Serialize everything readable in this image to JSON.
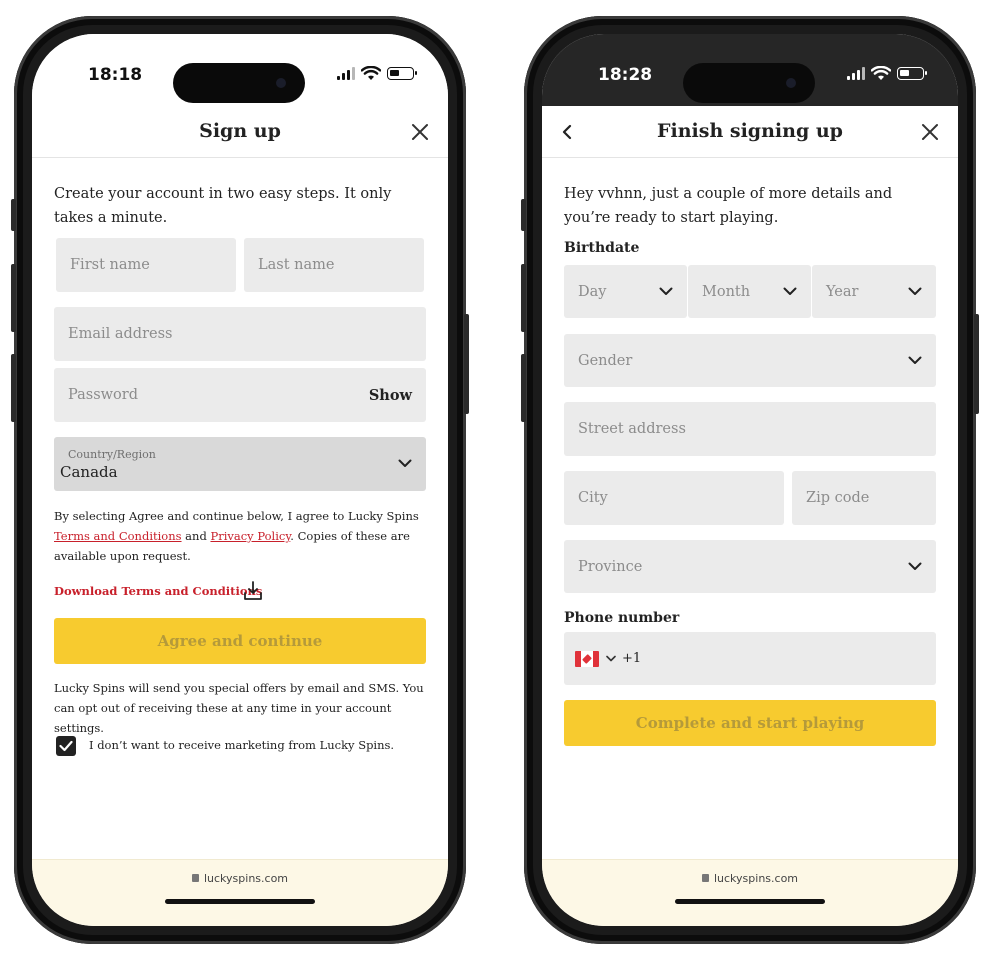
{
  "left_phone": {
    "status_time": "18:18",
    "header_title": "Sign up",
    "intro": "Create your account in two easy steps. It only takes a minute.",
    "first_name_placeholder": "First name",
    "last_name_placeholder": "Last name",
    "email_placeholder": "Email address",
    "password_placeholder": "Password",
    "show_label": "Show",
    "country_label": "Country/Region",
    "country_value": "Canada",
    "consent_text_1": "By selecting Agree and continue below, I agree to Lucky Spins ",
    "terms_link": "Terms and Conditions",
    "consent_and": " and ",
    "privacy_link": "Privacy Policy",
    "consent_text_2": ". Copies of these are available upon request.",
    "download_link": "Download Terms and Conditions",
    "cta_label": "Agree and continue",
    "marketing_text": "Lucky Spins will send you special offers by email and SMS. You can opt out of receiving these at any time in your account settings.",
    "marketing_checkbox_label": "I don’t want to receive marketing from Lucky Spins.",
    "marketing_checked": true,
    "url": "luckyspins.com"
  },
  "right_phone": {
    "status_time": "18:28",
    "header_title": "Finish signing up",
    "intro": "Hey vvhnn, just a couple of more details and you’re ready to start playing.",
    "birthdate_label": "Birthdate",
    "day_placeholder": "Day",
    "month_placeholder": "Month",
    "year_placeholder": "Year",
    "gender_placeholder": "Gender",
    "street_placeholder": "Street address",
    "city_placeholder": "City",
    "zip_placeholder": "Zip code",
    "province_placeholder": "Province",
    "phone_label": "Phone number",
    "dial_code": "+1",
    "flag_icon": "canada-flag-icon",
    "cta_label": "Complete and start playing",
    "url": "luckyspins.com"
  },
  "colors": {
    "cta_yellow": "#f7cb2f",
    "cta_text_disabled": "#b59a3a",
    "link_red": "#c8202b",
    "field_bg": "#ebebeb",
    "footer_bg": "#fdf8e6"
  }
}
